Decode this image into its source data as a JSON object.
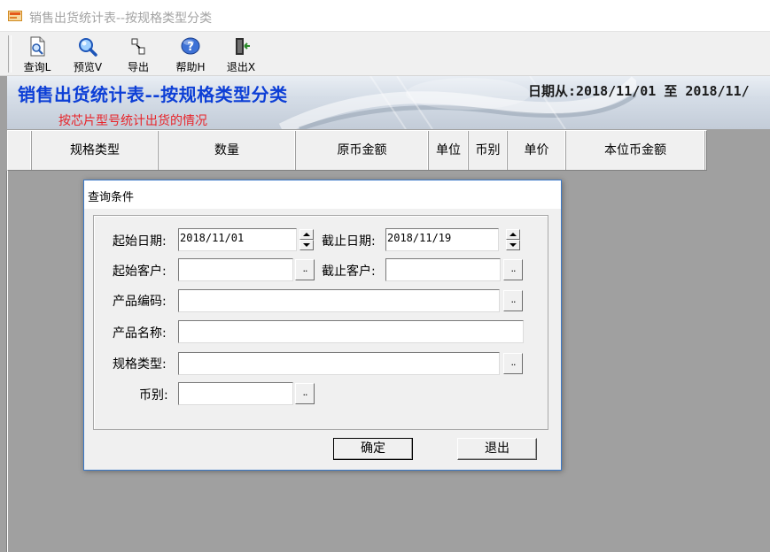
{
  "window": {
    "title": "销售出货统计表--按规格类型分类",
    "icon": "app-logo-icon"
  },
  "toolbar": {
    "items": [
      {
        "label": "查询L",
        "icon": "document-search-icon"
      },
      {
        "label": "预览V",
        "icon": "magnifier-icon"
      },
      {
        "label": "导出",
        "icon": "export-icon"
      },
      {
        "label": "帮助H",
        "icon": "help-icon"
      },
      {
        "label": "退出X",
        "icon": "exit-door-icon"
      }
    ]
  },
  "banner": {
    "title": "销售出货统计表--按规格类型分类",
    "subtitle": "按芯片型号统计出货的情况",
    "date_range": "日期从:2018/11/01 至 2018/11/"
  },
  "grid": {
    "columns": [
      "",
      "规格类型",
      "数量",
      "原币金额",
      "单位",
      "币别",
      "单价",
      "本位币金额"
    ]
  },
  "dialog": {
    "title": "查询条件",
    "fields": {
      "start_date": {
        "label": "起始日期:",
        "value": "2018/11/01"
      },
      "end_date": {
        "label": "截止日期:",
        "value": "2018/11/19"
      },
      "start_customer": {
        "label": "起始客户:",
        "value": ""
      },
      "end_customer": {
        "label": "截止客户:",
        "value": ""
      },
      "product_code": {
        "label": "产品编码:",
        "value": ""
      },
      "product_name": {
        "label": "产品名称:",
        "value": ""
      },
      "spec_type": {
        "label": "规格类型:",
        "value": ""
      },
      "currency": {
        "label": "币别:",
        "value": ""
      }
    },
    "browse_label": "..",
    "ok_label": "确定",
    "exit_label": "退出"
  },
  "colors": {
    "banner_title": "#0d3fd6",
    "banner_subtitle": "#e8242a",
    "workspace": "#a0a0a0"
  }
}
